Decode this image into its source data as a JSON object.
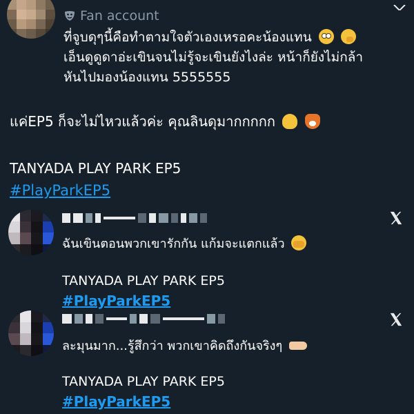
{
  "main_post": {
    "account_label": "Fan account",
    "label_icon": "theater-mask-icon",
    "text_lines": [
      "ที่จูบดุๆนี้คือทำตามใจตัวเองเหรอคะน้องแทน",
      "เอ็นดูดูดาอ่ะเขินจนไม่รู้จะเขินยังไงล่ะ หน้าก็ยังไม่กล้า",
      "หันไปมองน้องแทน 5555555"
    ],
    "line1_emojis": [
      "flushed-face",
      "face-with-hand-over-mouth"
    ],
    "ep_line": "แค่EP5 ก็จะไม่ไหวแล้วค่ะ คุณลินดุมากกกกก",
    "ep_line_emojis": [
      "melting-face",
      "fox"
    ],
    "show_title": "TANYADA PLAY PARK EP5",
    "hashtag": "#PlayParkEP5"
  },
  "quoted_posts": [
    {
      "text": "ฉันเขินตอนพวกเขารักกัน แก้มจะแตกแล้ว",
      "emoji": "face-with-peeking-eye",
      "show_title": "TANYADA PLAY PARK EP5",
      "hashtag": "#PlayParkEP5",
      "platform_icon": "x-logo-icon"
    },
    {
      "text": "ละมุนมาก...รู้สึกว่า พวกเขาคิดถึงกันจริงๆ",
      "emoji": "left-pointing-hand",
      "show_title": "TANYADA PLAY PARK EP5",
      "hashtag": "#PlayParkEP5",
      "platform_icon": "x-logo-icon"
    }
  ],
  "colors": {
    "background": "#15202b",
    "text": "#ffffff",
    "muted": "#8b98a5",
    "link": "#1d9bf0"
  }
}
